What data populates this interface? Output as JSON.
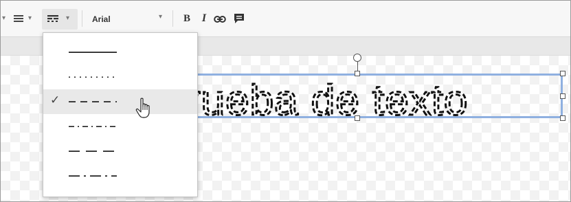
{
  "toolbar": {
    "font_name": "Arial",
    "align_icon": "align-icon",
    "line_dash_icon": "line-dash-icon",
    "bold_label": "B",
    "italic_label": "I",
    "link_icon": "link-icon",
    "comment_icon": "comment-icon"
  },
  "canvas": {
    "text": "rueba de texto"
  },
  "dash_menu": {
    "items": [
      {
        "style": "solid"
      },
      {
        "style": "dotted"
      },
      {
        "style": "dashed",
        "selected": true
      },
      {
        "style": "dash-dot"
      },
      {
        "style": "long-dash"
      },
      {
        "style": "long-dash-dot"
      }
    ]
  },
  "colors": {
    "selection_border": "#8fb0e0",
    "menu_hover": "#e9e9e9",
    "toolbar_bg": "#f7f7f7"
  }
}
